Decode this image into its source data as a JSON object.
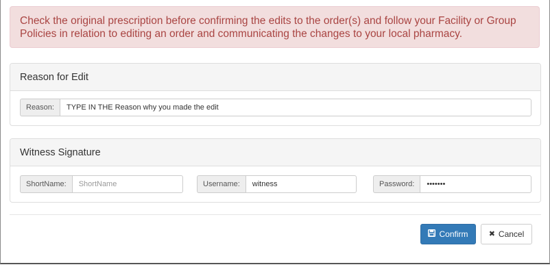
{
  "alert": {
    "message": "Check the original prescription before confirming the edits to the order(s) and follow your Facility or Group Policies in relation to editing an order and communicating the changes to your local pharmacy."
  },
  "reason_panel": {
    "title": "Reason for Edit",
    "reason_label": "Reason:",
    "reason_value": "TYPE IN THE Reason why you made the edit"
  },
  "witness_panel": {
    "title": "Witness Signature",
    "shortname_label": "ShortName:",
    "shortname_placeholder": "ShortName",
    "shortname_value": "",
    "username_label": "Username:",
    "username_value": "witness",
    "password_label": "Password:",
    "password_value": "•••••••"
  },
  "footer": {
    "confirm_label": "Confirm",
    "confirm_icon": "save-icon",
    "cancel_label": "Cancel",
    "cancel_icon": "close-icon"
  },
  "colors": {
    "alert_bg": "#f2dede",
    "alert_text": "#a94442",
    "primary": "#337ab7"
  }
}
